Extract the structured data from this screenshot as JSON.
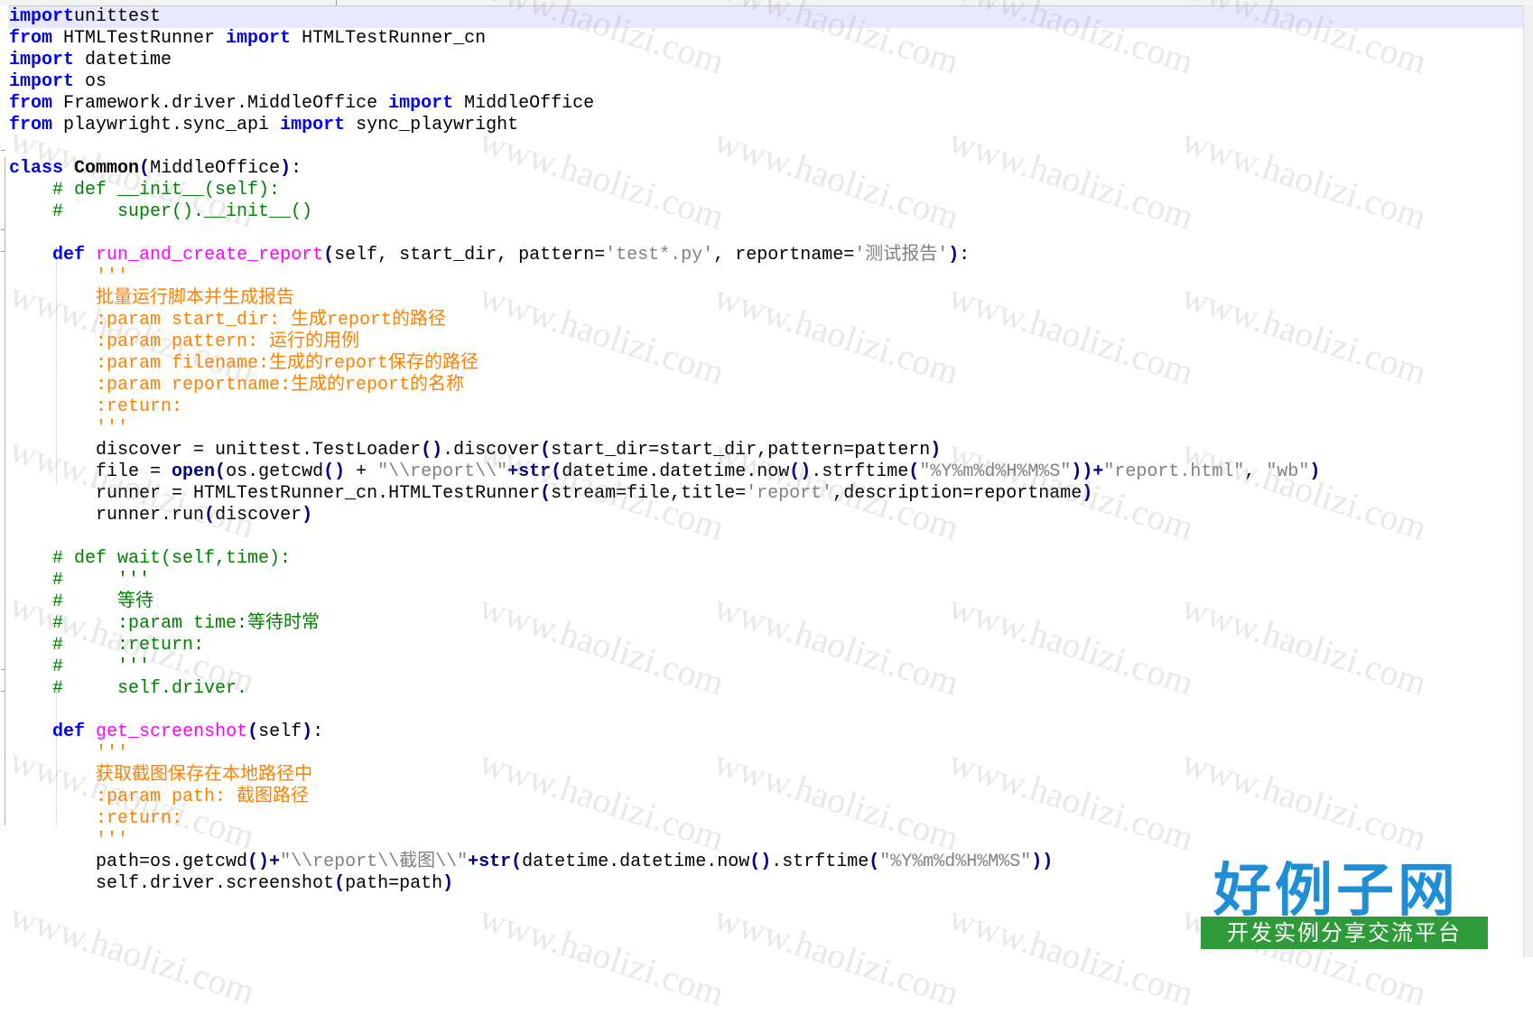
{
  "code": [
    [
      [
        "kw",
        "import"
      ],
      [
        "",
        "unittest"
      ]
    ],
    [
      [
        "kw",
        "from"
      ],
      [
        "",
        " HTMLTestRunner "
      ],
      [
        "kw",
        "import"
      ],
      [
        "",
        " HTMLTestRunner_cn"
      ]
    ],
    [
      [
        "kw",
        "import"
      ],
      [
        "",
        " datetime"
      ]
    ],
    [
      [
        "kw",
        "import"
      ],
      [
        "",
        " os"
      ]
    ],
    [
      [
        "kw",
        "from"
      ],
      [
        "",
        " Framework.driver.MiddleOffice "
      ],
      [
        "kw",
        "import"
      ],
      [
        "",
        " MiddleOffice"
      ]
    ],
    [
      [
        "kw",
        "from"
      ],
      [
        "",
        " playwright.sync_api "
      ],
      [
        "kw",
        "import"
      ],
      [
        "",
        " sync_playwright"
      ]
    ],
    [],
    [
      [
        "kw",
        "class"
      ],
      [
        "",
        " "
      ],
      [
        "cls",
        "Common"
      ],
      [
        "op",
        "("
      ],
      [
        "",
        "MiddleOffice"
      ],
      [
        "op",
        ")"
      ],
      [
        "",
        ":"
      ]
    ],
    [
      [
        "cmt",
        "    # def __init__(self):"
      ]
    ],
    [
      [
        "cmt",
        "    #     super().__init__()"
      ]
    ],
    [],
    [
      [
        "",
        "    "
      ],
      [
        "kw",
        "def"
      ],
      [
        "",
        " "
      ],
      [
        "fn",
        "run_and_create_report"
      ],
      [
        "op",
        "("
      ],
      [
        "",
        "self, start_dir, pattern="
      ],
      [
        "str",
        "'test*.py'"
      ],
      [
        "",
        ", reportname="
      ],
      [
        "str",
        "'测试报告'"
      ],
      [
        "op",
        ")"
      ],
      [
        "",
        ":"
      ]
    ],
    [
      [
        "doc",
        "        '''"
      ]
    ],
    [
      [
        "doc",
        "        批量运行脚本并生成报告"
      ]
    ],
    [
      [
        "doc",
        "        :param start_dir: 生成report的路径"
      ]
    ],
    [
      [
        "doc",
        "        :param pattern: 运行的用例"
      ]
    ],
    [
      [
        "doc",
        "        :param filename:生成的report保存的路径"
      ]
    ],
    [
      [
        "doc",
        "        :param reportname:生成的report的名称"
      ]
    ],
    [
      [
        "doc",
        "        :return:"
      ]
    ],
    [
      [
        "doc",
        "        '''"
      ]
    ],
    [
      [
        "",
        "        discover = unittest.TestLoader"
      ],
      [
        "op",
        "()"
      ],
      [
        "",
        ".discover"
      ],
      [
        "op",
        "("
      ],
      [
        "",
        "start_dir=start_dir,pattern=pattern"
      ],
      [
        "op",
        ")"
      ]
    ],
    [
      [
        "",
        "        file = "
      ],
      [
        "bi",
        "open"
      ],
      [
        "op",
        "("
      ],
      [
        "",
        "os.getcwd"
      ],
      [
        "op",
        "()"
      ],
      [
        "",
        " + "
      ],
      [
        "str",
        "\"\\\\report\\\\\""
      ],
      [
        "op",
        "+"
      ],
      [
        "bi",
        "str"
      ],
      [
        "op",
        "("
      ],
      [
        "",
        "datetime.datetime.now"
      ],
      [
        "op",
        "()"
      ],
      [
        "",
        ".strftime"
      ],
      [
        "op",
        "("
      ],
      [
        "str",
        "\"%Y%m%d%H%M%S\""
      ],
      [
        "op",
        "))+"
      ],
      [
        "str",
        "\"report.html\""
      ],
      [
        "",
        ", "
      ],
      [
        "str",
        "\"wb\""
      ],
      [
        "op",
        ")"
      ]
    ],
    [
      [
        "",
        "        runner = HTMLTestRunner_cn.HTMLTestRunner"
      ],
      [
        "op",
        "("
      ],
      [
        "",
        "stream=file,title="
      ],
      [
        "str",
        "'report'"
      ],
      [
        "",
        ",description=reportname"
      ],
      [
        "op",
        ")"
      ]
    ],
    [
      [
        "",
        "        runner.run"
      ],
      [
        "op",
        "("
      ],
      [
        "",
        "discover"
      ],
      [
        "op",
        ")"
      ]
    ],
    [],
    [
      [
        "cmt",
        "    # def wait(self,time):"
      ]
    ],
    [
      [
        "cmt",
        "    #     '''"
      ]
    ],
    [
      [
        "cmt",
        "    #     等待"
      ]
    ],
    [
      [
        "cmt",
        "    #     :param time:等待时常"
      ]
    ],
    [
      [
        "cmt",
        "    #     :return:"
      ]
    ],
    [
      [
        "cmt",
        "    #     '''"
      ]
    ],
    [
      [
        "cmt",
        "    #     self.driver."
      ]
    ],
    [],
    [
      [
        "",
        "    "
      ],
      [
        "kw",
        "def"
      ],
      [
        "",
        " "
      ],
      [
        "fn",
        "get_screenshot"
      ],
      [
        "op",
        "("
      ],
      [
        "",
        "self"
      ],
      [
        "op",
        ")"
      ],
      [
        "",
        ":"
      ]
    ],
    [
      [
        "doc",
        "        '''"
      ]
    ],
    [
      [
        "doc",
        "        获取截图保存在本地路径中"
      ]
    ],
    [
      [
        "doc",
        "        :param path: 截图路径"
      ]
    ],
    [
      [
        "doc",
        "        :return:"
      ]
    ],
    [
      [
        "doc",
        "        '''"
      ]
    ],
    [
      [
        "",
        "        path=os.getcwd"
      ],
      [
        "op",
        "()"
      ],
      [
        "op",
        "+"
      ],
      [
        "str",
        "\"\\\\report\\\\截图\\\\\""
      ],
      [
        "op",
        "+"
      ],
      [
        "bi",
        "str"
      ],
      [
        "op",
        "("
      ],
      [
        "",
        "datetime.datetime.now"
      ],
      [
        "op",
        "()"
      ],
      [
        "",
        ".strftime"
      ],
      [
        "op",
        "("
      ],
      [
        "str",
        "\"%Y%m%d%H%M%S\""
      ],
      [
        "op",
        "))"
      ]
    ],
    [
      [
        "",
        "        self.driver.screenshot"
      ],
      [
        "op",
        "("
      ],
      [
        "",
        "path=path"
      ],
      [
        "op",
        ")"
      ]
    ]
  ],
  "watermark": "www.haolizi.com",
  "logo": {
    "title": "好例子网",
    "subtitle": "开发实例分享交流平台"
  }
}
